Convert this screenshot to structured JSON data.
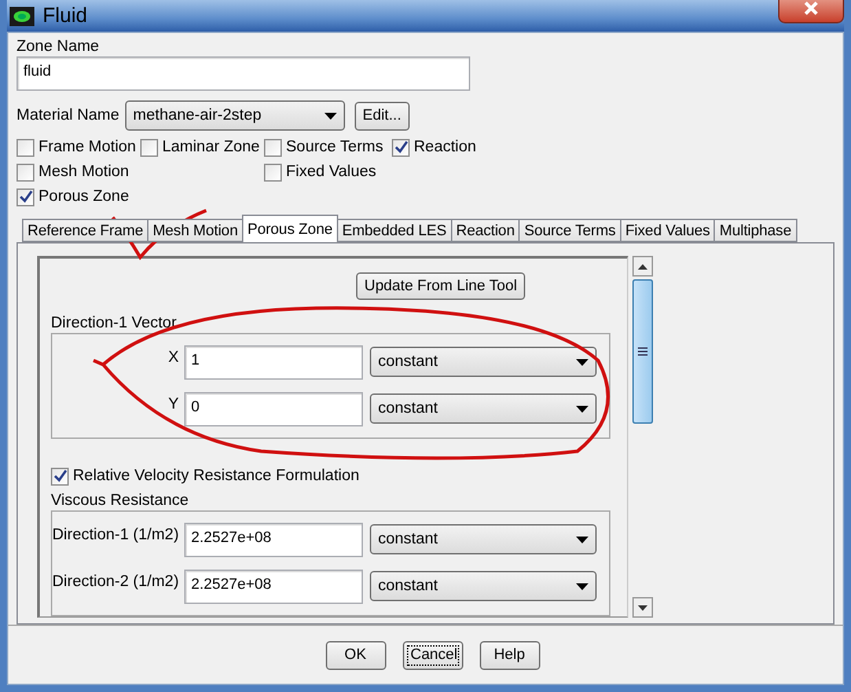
{
  "window": {
    "title": "Fluid"
  },
  "zone_name": {
    "label": "Zone Name",
    "value": "fluid"
  },
  "material": {
    "label": "Material Name",
    "value": "methane-air-2step",
    "button": "Edit..."
  },
  "option_columns": [
    [
      {
        "label": "Frame Motion",
        "checked": false
      },
      {
        "label": "Mesh Motion",
        "checked": false
      },
      {
        "label": "Porous Zone",
        "checked": true
      }
    ],
    [
      {
        "label": "Laminar Zone",
        "checked": false
      }
    ],
    [
      {
        "label": "Source Terms",
        "checked": false
      },
      {
        "label": "Fixed Values",
        "checked": false
      }
    ],
    [
      {
        "label": "Reaction",
        "checked": true
      }
    ]
  ],
  "tabs": [
    {
      "label": "Reference Frame",
      "selected": false
    },
    {
      "label": "Mesh Motion",
      "selected": false
    },
    {
      "label": "Porous Zone",
      "selected": true
    },
    {
      "label": "Embedded LES",
      "selected": false
    },
    {
      "label": "Reaction",
      "selected": false
    },
    {
      "label": "Source Terms",
      "selected": false
    },
    {
      "label": "Fixed Values",
      "selected": false
    },
    {
      "label": "Multiphase",
      "selected": false
    }
  ],
  "panel": {
    "update_button": "Update From Line Tool",
    "direction_vector": {
      "title": "Direction-1 Vector",
      "rows": [
        {
          "label": "X",
          "value": "1",
          "method": "constant"
        },
        {
          "label": "Y",
          "value": "0",
          "method": "constant"
        }
      ]
    },
    "relative_velocity": {
      "label": "Relative Velocity Resistance Formulation",
      "checked": true
    },
    "viscous_resistance": {
      "title": "Viscous Resistance",
      "rows": [
        {
          "label": "Direction-1 (1/m2)",
          "value": "2.2527e+08",
          "method": "constant"
        },
        {
          "label": "Direction-2 (1/m2)",
          "value": "2.2527e+08",
          "method": "constant"
        }
      ]
    }
  },
  "buttons": [
    {
      "label": "OK",
      "focused": false
    },
    {
      "label": "Cancel",
      "focused": true
    },
    {
      "label": "Help",
      "focused": false
    }
  ]
}
